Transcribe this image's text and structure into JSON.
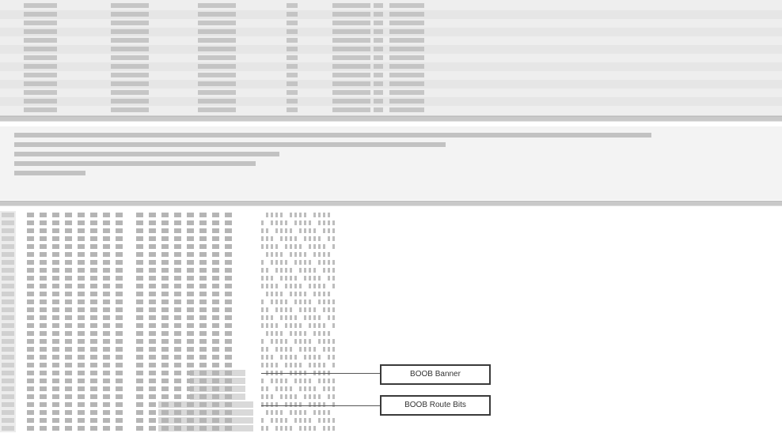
{
  "packet_list": {
    "rows": [
      {
        "text": ""
      },
      {
        "text": ""
      },
      {
        "text": ""
      },
      {
        "text": ""
      },
      {
        "text": ""
      },
      {
        "text": ""
      },
      {
        "text": ""
      },
      {
        "text": ""
      },
      {
        "text": ""
      },
      {
        "text": ""
      },
      {
        "text": ""
      },
      {
        "text": ""
      },
      {
        "text": ""
      }
    ]
  },
  "details": {
    "lines": [
      {
        "text": ""
      },
      {
        "text": ""
      },
      {
        "text": ""
      },
      {
        "text": ""
      },
      {
        "text": ""
      }
    ]
  },
  "hex_dump": {
    "lines": [
      {
        "text": ""
      },
      {
        "text": ""
      },
      {
        "text": ""
      },
      {
        "text": ""
      },
      {
        "text": ""
      },
      {
        "text": ""
      },
      {
        "text": ""
      },
      {
        "text": ""
      },
      {
        "text": ""
      },
      {
        "text": ""
      },
      {
        "text": ""
      },
      {
        "text": ""
      },
      {
        "text": ""
      },
      {
        "text": ""
      },
      {
        "text": ""
      },
      {
        "text": ""
      },
      {
        "text": ""
      },
      {
        "text": ""
      },
      {
        "text": ""
      },
      {
        "text": ""
      },
      {
        "text": ""
      },
      {
        "text": ""
      },
      {
        "text": ""
      },
      {
        "text": ""
      },
      {
        "text": ""
      },
      {
        "text": ""
      },
      {
        "text": ""
      },
      {
        "text": ""
      }
    ]
  },
  "callouts": [
    {
      "label": "BOOB Banner"
    },
    {
      "label": "BOOB Route Bits"
    }
  ]
}
